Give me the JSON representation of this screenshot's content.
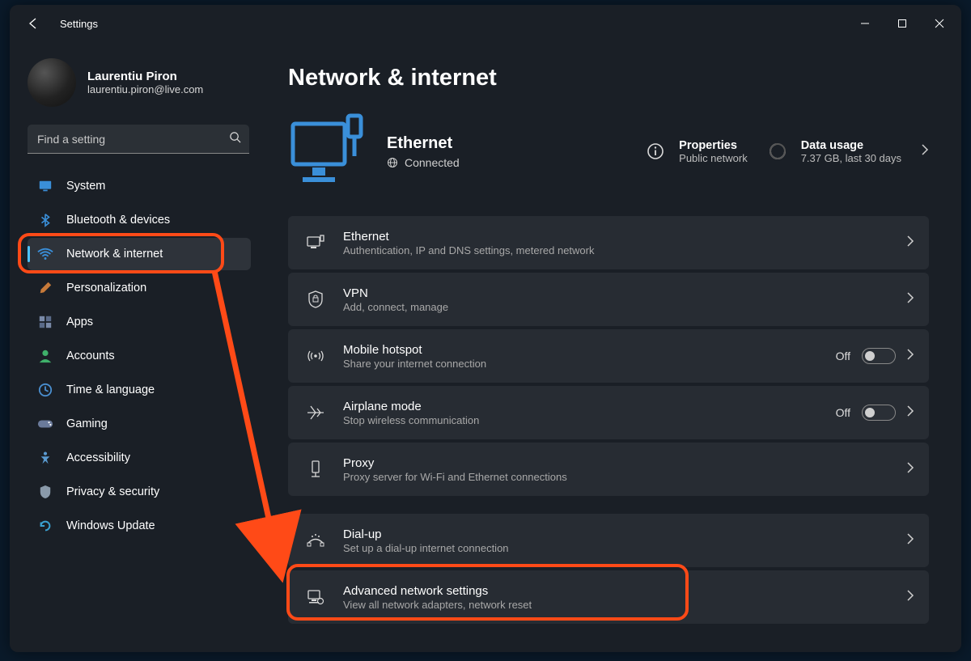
{
  "window": {
    "title": "Settings"
  },
  "user": {
    "name": "Laurentiu Piron",
    "email": "laurentiu.piron@live.com"
  },
  "search": {
    "placeholder": "Find a setting"
  },
  "sidebar": {
    "items": [
      {
        "label": "System"
      },
      {
        "label": "Bluetooth & devices"
      },
      {
        "label": "Network & internet"
      },
      {
        "label": "Personalization"
      },
      {
        "label": "Apps"
      },
      {
        "label": "Accounts"
      },
      {
        "label": "Time & language"
      },
      {
        "label": "Gaming"
      },
      {
        "label": "Accessibility"
      },
      {
        "label": "Privacy & security"
      },
      {
        "label": "Windows Update"
      }
    ]
  },
  "page": {
    "title": "Network & internet"
  },
  "hero": {
    "connection": "Ethernet",
    "status": "Connected",
    "properties": {
      "label": "Properties",
      "sub": "Public network"
    },
    "data": {
      "label": "Data usage",
      "sub": "7.37 GB, last 30 days"
    }
  },
  "cards": [
    {
      "title": "Ethernet",
      "sub": "Authentication, IP and DNS settings, metered network",
      "toggle": null
    },
    {
      "title": "VPN",
      "sub": "Add, connect, manage",
      "toggle": null
    },
    {
      "title": "Mobile hotspot",
      "sub": "Share your internet connection",
      "toggle": "Off"
    },
    {
      "title": "Airplane mode",
      "sub": "Stop wireless communication",
      "toggle": "Off"
    },
    {
      "title": "Proxy",
      "sub": "Proxy server for Wi-Fi and Ethernet connections",
      "toggle": null
    },
    {
      "title": "Dial-up",
      "sub": "Set up a dial-up internet connection",
      "toggle": null
    },
    {
      "title": "Advanced network settings",
      "sub": "View all network adapters, network reset",
      "toggle": null
    }
  ]
}
